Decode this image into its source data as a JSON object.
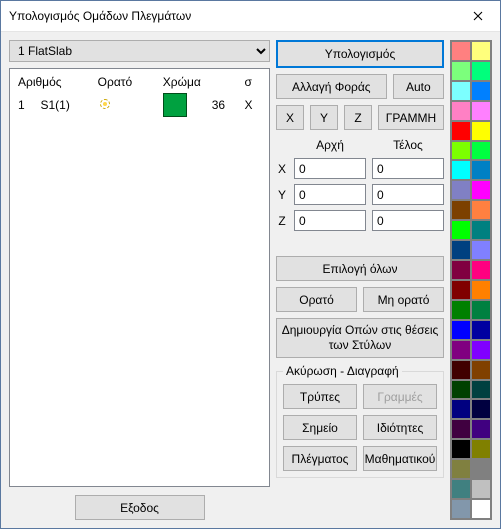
{
  "window": {
    "title": "Υπολογισμός Ομάδων Πλεγμάτων"
  },
  "dropdown": {
    "selected": "1 FlatSlab"
  },
  "table": {
    "headers": {
      "num": "Αριθμός",
      "visible": "Ορατό",
      "color": "Χρώμα",
      "sigma": "σ"
    },
    "rows": [
      {
        "idx": "1",
        "name": "S1(1)",
        "color": "#00a140",
        "color_value": "36",
        "sigma": "X"
      }
    ]
  },
  "exit": "Εξοδος",
  "calc": "Υπολογισμός",
  "change_dir": "Αλλαγή Φοράς",
  "auto": "Auto",
  "axis_x": "X",
  "axis_y": "Y",
  "axis_z": "Z",
  "line_btn": "ΓΡΑΜΜΗ",
  "start": "Αρχή",
  "end": "Τέλος",
  "coords": {
    "x0": "0",
    "x1": "0",
    "y0": "0",
    "y1": "0",
    "z0": "0",
    "z1": "0"
  },
  "select_all": "Επιλογή όλων",
  "visible": "Ορατό",
  "invisible": "Μη ορατό",
  "holes": "Δημιουργία Οπών στις θέσεις των Στύλων",
  "cancel_legend": "Ακύρωση - Διαγραφή",
  "holes2": "Τρύπες",
  "lines": "Γραμμές",
  "point": "Σημείο",
  "props": "Ιδιότητες",
  "mesh": "Πλέγματος",
  "math": "Μαθηματικού",
  "palette": [
    "#ff8080",
    "#ffff7c",
    "#7cff7c",
    "#00ff7c",
    "#7cffff",
    "#0080ff",
    "#ff80c4",
    "#ff80ff",
    "#ff0000",
    "#ffff00",
    "#7cff00",
    "#00ff40",
    "#00ffff",
    "#0080c4",
    "#8080c4",
    "#ff00ff",
    "#7c4000",
    "#ff8040",
    "#00ff00",
    "#008080",
    "#004080",
    "#8080ff",
    "#800040",
    "#ff0080",
    "#800000",
    "#ff8000",
    "#008000",
    "#008040",
    "#0000ff",
    "#0000a0",
    "#800080",
    "#8000ff",
    "#400000",
    "#804000",
    "#004000",
    "#004040",
    "#000080",
    "#000040",
    "#400040",
    "#400080",
    "#000000",
    "#808000",
    "#808040",
    "#808080",
    "#408080",
    "#c0c0c0",
    "#8297ab",
    "#ffffff"
  ]
}
